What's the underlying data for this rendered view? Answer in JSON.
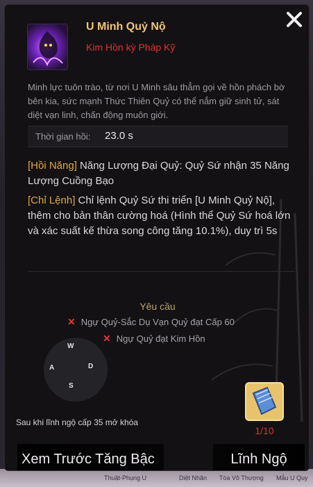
{
  "skill": {
    "name": "U Minh Quỷ Nộ",
    "type": "Kim Hồn kỳ Pháp Kỹ",
    "description": "Minh lực tuôn trào, từ nơi U Minh sâu thẳm gọi về hồn phách bờ bên kia, sức mạnh Thức Thiên Quỷ có thể nắm giữ sinh tử, sát diệt vạn linh, chấn động muôn giới.",
    "cooldown_label": "Thời gian hồi:",
    "cooldown_value": "23.0 s",
    "effects": [
      {
        "tag": "[Hồi Năng]",
        "text": " Năng Lượng Đại Quỷ: Quỷ Sứ nhận 35 Năng Lượng Cuồng Bạo"
      },
      {
        "tag": "[Chỉ Lệnh]",
        "text": " Chỉ lệnh Quỷ Sứ thi triển [U Minh Quỷ Nộ], thêm cho bản thân cường hoá (Hình thể Quỷ Sứ hoá lớn và xác suất kế thừa song công tăng 10.1%), duy trì 5s"
      }
    ]
  },
  "requirements": {
    "title": "Yêu cầu",
    "items": [
      {
        "icon": "x-mark-icon",
        "text": "Ngự Quỷ-Sắc Dụ Vạn Quỷ  đạt Cấp 60"
      },
      {
        "icon": "x-mark-icon",
        "text": "Ngự Quỷ đạt Kim Hồn"
      }
    ]
  },
  "controls": {
    "w": "W",
    "a": "A",
    "s": "S",
    "d": "D"
  },
  "item": {
    "icon": "skill-book-icon",
    "count": "1/10"
  },
  "unlock_note": "Sau khi lĩnh ngộ cấp 35 mở khóa",
  "buttons": {
    "preview": "Xem Trước Tăng Bậc",
    "learn": "Lĩnh Ngộ"
  },
  "background_labels": [
    "Thuật-Phụng U",
    "Diệt Nhãn",
    "Tòa Vô Thượng",
    "Mẫu U Quy"
  ],
  "colors": {
    "title": "#f0c674",
    "accent_red": "#e2322f",
    "tag": "#e0a93a"
  }
}
